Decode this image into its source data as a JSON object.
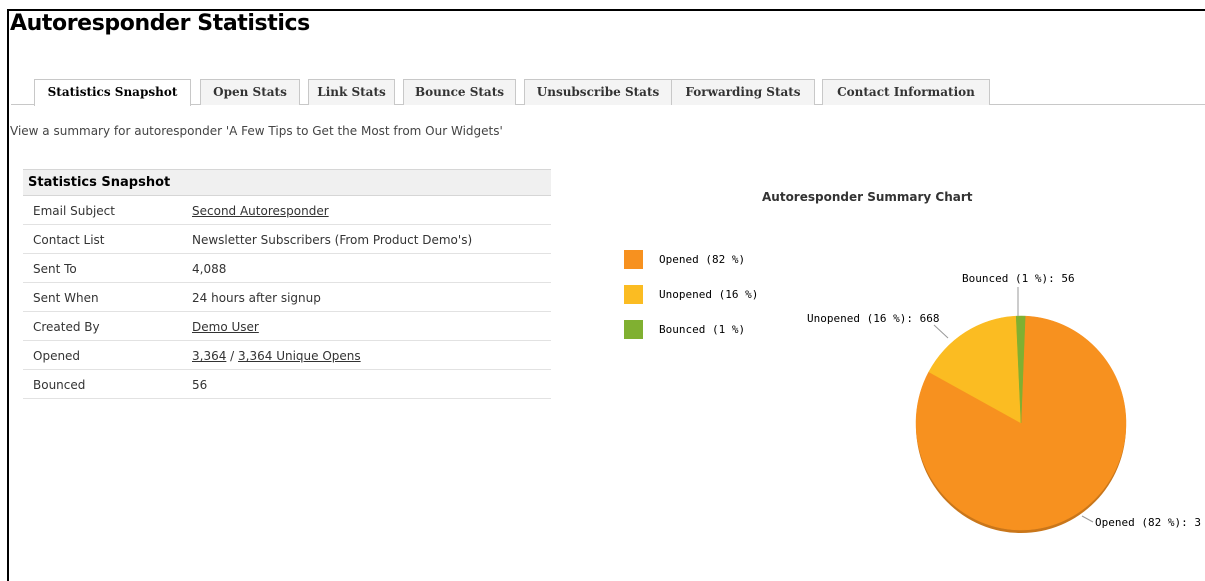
{
  "page": {
    "title": "Autoresponder Statistics",
    "description": "View a summary for autoresponder 'A Few Tips to Get the Most from Our Widgets'"
  },
  "tabs": [
    {
      "label": "Statistics Snapshot",
      "active": true
    },
    {
      "label": "Open Stats",
      "active": false
    },
    {
      "label": "Link Stats",
      "active": false
    },
    {
      "label": "Bounce Stats",
      "active": false
    },
    {
      "label": "Unsubscribe Stats",
      "active": false
    },
    {
      "label": "Forwarding Stats",
      "active": false
    },
    {
      "label": "Contact Information",
      "active": false
    }
  ],
  "snapshot": {
    "heading": "Statistics Snapshot",
    "rows": {
      "email_subject": {
        "key": "Email Subject",
        "value": "Second Autoresponder"
      },
      "contact_list": {
        "key": "Contact List",
        "value": "Newsletter Subscribers (From Product Demo's)"
      },
      "sent_to": {
        "key": "Sent To",
        "value": "4,088"
      },
      "sent_when": {
        "key": "Sent When",
        "value": "24 hours after signup"
      },
      "created_by": {
        "key": "Created By",
        "value": "Demo User"
      },
      "opened": {
        "key": "Opened",
        "value_total": "3,364",
        "separator": " / ",
        "value_unique": "3,364 Unique Opens"
      },
      "bounced": {
        "key": "Bounced",
        "value": "56"
      }
    }
  },
  "colors": {
    "opened": "#f7911f",
    "unopened": "#fbbc22",
    "bounced": "#80b031"
  },
  "chart_data": {
    "type": "pie",
    "title": "Autoresponder Summary Chart",
    "legend_position": "left",
    "slices": [
      {
        "name": "Opened (82 %)",
        "label": "Opened (82 %): 3",
        "value": 3364,
        "color": "#f7911f"
      },
      {
        "name": "Unopened (16 %)",
        "label": "Unopened (16 %): 668",
        "value": 668,
        "color": "#fbbc22"
      },
      {
        "name": "Bounced (1 %)",
        "label": "Bounced (1 %): 56",
        "value": 56,
        "color": "#80b031"
      }
    ]
  }
}
